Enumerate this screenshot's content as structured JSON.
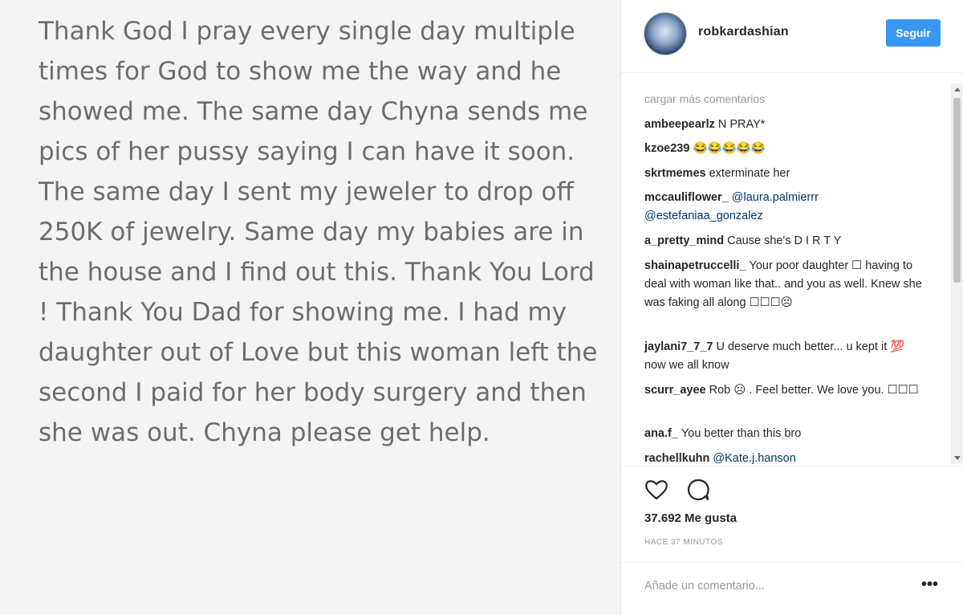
{
  "post": {
    "note_text": "Thank God I pray every single day multiple times for God to show me the way and he showed me. The same day Chyna sends me pics of her pussy saying I can have it soon. The same day I sent my jeweler to drop off 250K of jewelry. Same day my babies are in the house and I find out this. Thank You Lord ! Thank You Dad for showing me. I had my daughter out of Love but this woman left the second I paid for her body surgery and then she was out. Chyna please get help."
  },
  "header": {
    "username": "robkardashian",
    "follow_label": "Seguir"
  },
  "comments": {
    "load_more": "cargar más comentarios",
    "items": [
      {
        "user": "ambeepearlz",
        "text": "N PRAY*"
      },
      {
        "user": "kzoe239",
        "text": "😂😂😂😂😂"
      },
      {
        "user": "skrtmemes",
        "text": "exterminate her"
      },
      {
        "user": "mccauliflower_",
        "mention": "@laura.palmierrr @estefaniaa_gonzalez"
      },
      {
        "user": "a_pretty_mind",
        "text": "Cause she's D I R T Y"
      },
      {
        "user": "shainapetruccelli_",
        "text": "Your poor daughter ☐ having to deal with woman like that.. and you as well. Knew she was faking all along ☐☐☐☹"
      },
      {
        "user": "jaylani7_7_7",
        "text": "U deserve much better... u kept it 💯 now we all know"
      },
      {
        "user": "scurr_ayee",
        "text": "Rob ☹ . Feel better. We love you. ☐☐☐"
      },
      {
        "user": "ana.f_",
        "text": "You better than this bro"
      },
      {
        "user": "rachellkuhn",
        "mention": "@Kate.j.hanson"
      }
    ]
  },
  "footer": {
    "likes": "37.692 Me gusta",
    "time": "HACE 37 MINUTOS",
    "add_comment_placeholder": "Añade un comentario...",
    "more": "•••"
  },
  "icons": {
    "like": "heart-icon",
    "comment": "comment-bubble-icon",
    "more": "more-options-icon"
  },
  "colors": {
    "follow_button": "#3897f0",
    "mention": "#003569",
    "muted": "#999999",
    "text": "#262626"
  }
}
